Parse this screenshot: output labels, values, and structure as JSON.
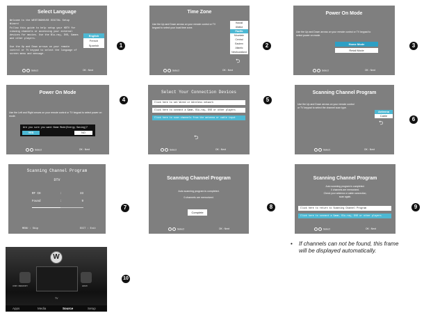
{
  "screens": {
    "s1": {
      "step": "1",
      "title": "Select Language",
      "welcome": "Welcome to the WESTINGHOUSE DIGITAL Setup Wizard",
      "para1": "Follow this guide to help setup your HDTV for viewing channels or accessing your external devices for movies. Use the Blu-ray, DVD, Games and other players.",
      "para2": "Use the Up and Down arrows on your remote control or TV keypad to select the language of screen menu and message.",
      "options": [
        "English",
        "French",
        "Spanish"
      ],
      "select_label": "Select",
      "next_label": "OK : Next"
    },
    "s2": {
      "step": "2",
      "title": "Time Zone",
      "para": "Use the Up and Down arrows on your remote control or TV keypad to select your local time zone.",
      "options": [
        "Hawaii",
        "Alaska",
        "Pacific",
        "Mountain",
        "Central",
        "Eastern",
        "Atlantic",
        "Newfoundland"
      ],
      "select_label": "Select",
      "next_label": "OK : Next",
      "return_glyph": "⮌"
    },
    "s3": {
      "step": "3",
      "title": "Power On Mode",
      "para": "Use the Up and Down arrows on your remote control or TV keypad to select power on mode.",
      "options": [
        "Home Mode",
        "Retail Mode"
      ],
      "select_label": "Select",
      "next_label": "OK : Next"
    },
    "s4": {
      "step": "4",
      "title": "Power On Mode",
      "para": "Use the Left and Right arrows on your remote control or TV keypad to select power on mode.",
      "confirm_text": "Are you sure you want Home Mode(Energy Saving)?",
      "yes_label": "YES",
      "no_label": "NO",
      "select_label": "Select",
      "next_label": "OK : Next"
    },
    "s5": {
      "step": "5",
      "title": "Select Your Connection Devices",
      "rows": [
        "Click here to set Wired or Wireless network",
        "Click here to connect a Game, Blu-ray, DVD or other players",
        "Click here to scan channels from the antenna or cable input"
      ],
      "select_label": "Select",
      "next_label": "OK : Next",
      "return_glyph": "⮌"
    },
    "s6": {
      "step": "6",
      "title": "Scanning Channel Program",
      "para": "Use the Up and Down arrows on your remote control or TV keypad to select the channel scan type.",
      "options": [
        "Antenna",
        "Cable"
      ],
      "select_label": "Select",
      "next_label": "OK : Next",
      "return_glyph": "⮌"
    },
    "s7": {
      "step": "7",
      "title": "Scanning Channel Program",
      "subtitle": "DTV",
      "rf_label": "RF CH",
      "rf_sep": ":",
      "rf_value": "33",
      "found_label": "Found",
      "found_sep": ":",
      "found_value": "9",
      "progress": 0.55,
      "skip_label": "MENU : Skip",
      "exit_label": "EXIT : Exit"
    },
    "s8": {
      "step": "8",
      "title": "Scanning Channel Program",
      "line1": "Auto scanning program is completed.",
      "line2": "0 channels are memorized.",
      "complete_label": "Complete",
      "select_label": "Select",
      "next_label": "OK : Next"
    },
    "s9": {
      "step": "9",
      "title": "Scanning Channel Program",
      "line1": "Auto scanning program is completed.",
      "line2": "0 channels are memorized.",
      "line3": "Check your antenna or cable connection,",
      "line4": "scan again.",
      "rows": [
        "Click here to return to Scanning Channel Program",
        "Click here to connect a Game, Blu-ray, DVD or other players"
      ],
      "select_label": "Select",
      "next_label": "OK : Next"
    },
    "s10": {
      "step": "10",
      "logo": "W",
      "labels": [
        "USB / MEMORY",
        "HDMI"
      ],
      "tv_label": "TV",
      "tabs": [
        "Apps",
        "Media",
        "Source",
        "Setup"
      ],
      "active_tab": "Source"
    }
  },
  "note": {
    "bullet": "•",
    "text": "If channels can not be found, this frame will be displayed automatically."
  },
  "colors": {
    "screen_bg": "#7f7f7f",
    "highlight": "#4db8d3",
    "step_badge": "#111111"
  }
}
